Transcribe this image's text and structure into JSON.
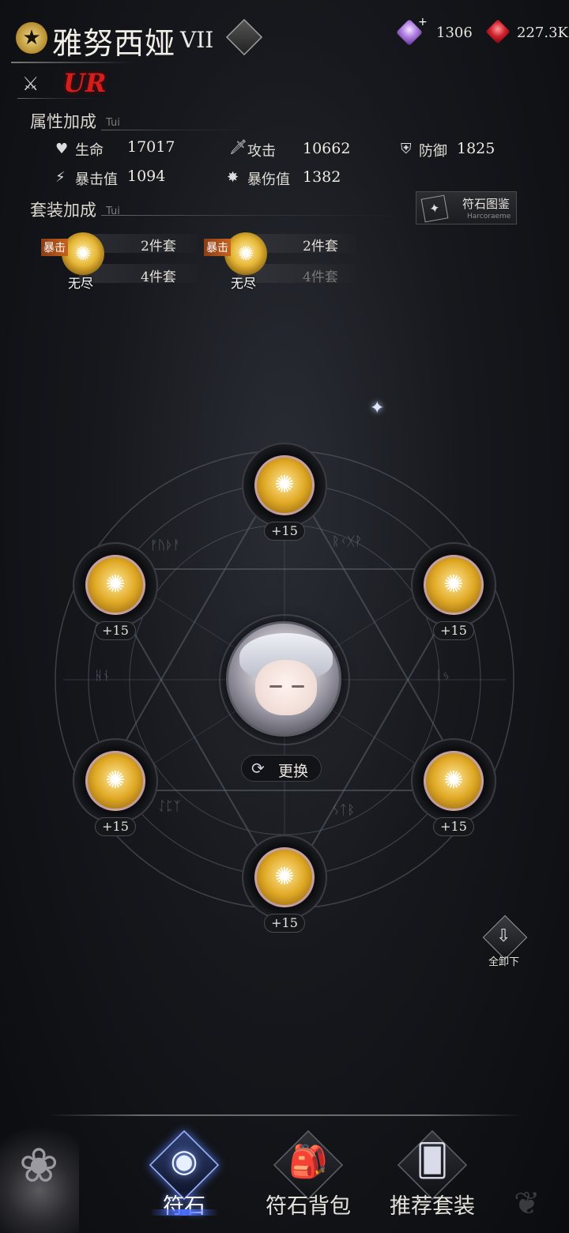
{
  "header": {
    "hero_name": "雅努西娅",
    "hero_rank": "VII",
    "rarity": "UR",
    "star_icon": "star-icon",
    "emblem_icon": "emblem-icon"
  },
  "currencies": [
    {
      "icon": "purple-crystal-icon",
      "value": "1306",
      "color": "#b98be8"
    },
    {
      "icon": "red-gem-icon",
      "value": "227.3K",
      "color": "#d0212d"
    }
  ],
  "attributes": {
    "title": "属性加成",
    "subtitle": "Tui",
    "stats": [
      {
        "icon": "heart-icon",
        "label": "生命",
        "value": "17017"
      },
      {
        "icon": "sword-icon",
        "label": "攻击",
        "value": "10662"
      },
      {
        "icon": "shield-icon",
        "label": "防御",
        "value": "1825"
      },
      {
        "icon": "crit-icon",
        "label": "暴击值",
        "value": "1094"
      },
      {
        "icon": "crit-damage-icon",
        "label": "暴伤值",
        "value": "1382"
      }
    ]
  },
  "set_bonus": {
    "title": "套装加成",
    "subtitle": "Tui",
    "codex_button": {
      "label": "符石图鉴",
      "sub": "Harcoraeme"
    },
    "groups": [
      {
        "tag_top": "暴击",
        "tag_bottom": "无尽",
        "row1": "2件套",
        "row2": "4件套",
        "row2_active": true
      },
      {
        "tag_top": "暴击",
        "tag_bottom": "无尽",
        "row1": "2件套",
        "row2": "4件套",
        "row2_active": false
      }
    ]
  },
  "slots": [
    {
      "level": "+15"
    },
    {
      "level": "+15"
    },
    {
      "level": "+15"
    },
    {
      "level": "+15"
    },
    {
      "level": "+15"
    },
    {
      "level": "+15"
    }
  ],
  "center": {
    "swap_label": "更换"
  },
  "unequip": {
    "label": "全卸下"
  },
  "nav": [
    {
      "label": "符石",
      "active": true
    },
    {
      "label": "符石背包",
      "active": false
    },
    {
      "label": "推荐套装",
      "active": false
    }
  ],
  "colors": {
    "accent_gold": "#e0a924",
    "rarity_red": "#d41e1e",
    "active_blue": "#4b6fff"
  }
}
